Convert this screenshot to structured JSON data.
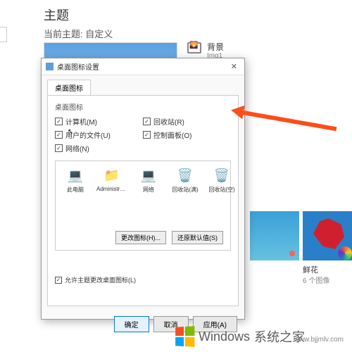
{
  "bg": {
    "title": "主题",
    "subtitle": "当前主题: 自定义",
    "side_label": "背景",
    "side_sub": "Img1"
  },
  "dialog": {
    "title": "桌面图标设置",
    "tab": "桌面图标",
    "group": "桌面图标",
    "close": "✕",
    "checks": {
      "computer": "计算机(M)",
      "recycle": "回收站(R)",
      "userfiles": "用户的文件(U)",
      "control": "控制面板(O)",
      "network": "网络(N)"
    },
    "icons": [
      {
        "name": "此电脑",
        "glyph": "💻"
      },
      {
        "name": "Administrat...",
        "glyph": "📁"
      },
      {
        "name": "网络",
        "glyph": "💻"
      },
      {
        "name": "回收站(满)",
        "glyph": "🗑️"
      },
      {
        "name": "回收站(空)",
        "glyph": "🗑️"
      }
    ],
    "change_icon": "更改图标(H)...",
    "restore_default": "还原默认值(S)",
    "allow_theme": "允许主题更改桌面图标(L)",
    "ok": "确定",
    "cancel": "取消",
    "apply": "应用(A)"
  },
  "themes": {
    "flower_label": "鲜花",
    "flower_sub": "6 个图像"
  },
  "watermark": {
    "main": "Windows",
    "sub": "系统之家",
    "url": "www.bjjmlv.com"
  }
}
